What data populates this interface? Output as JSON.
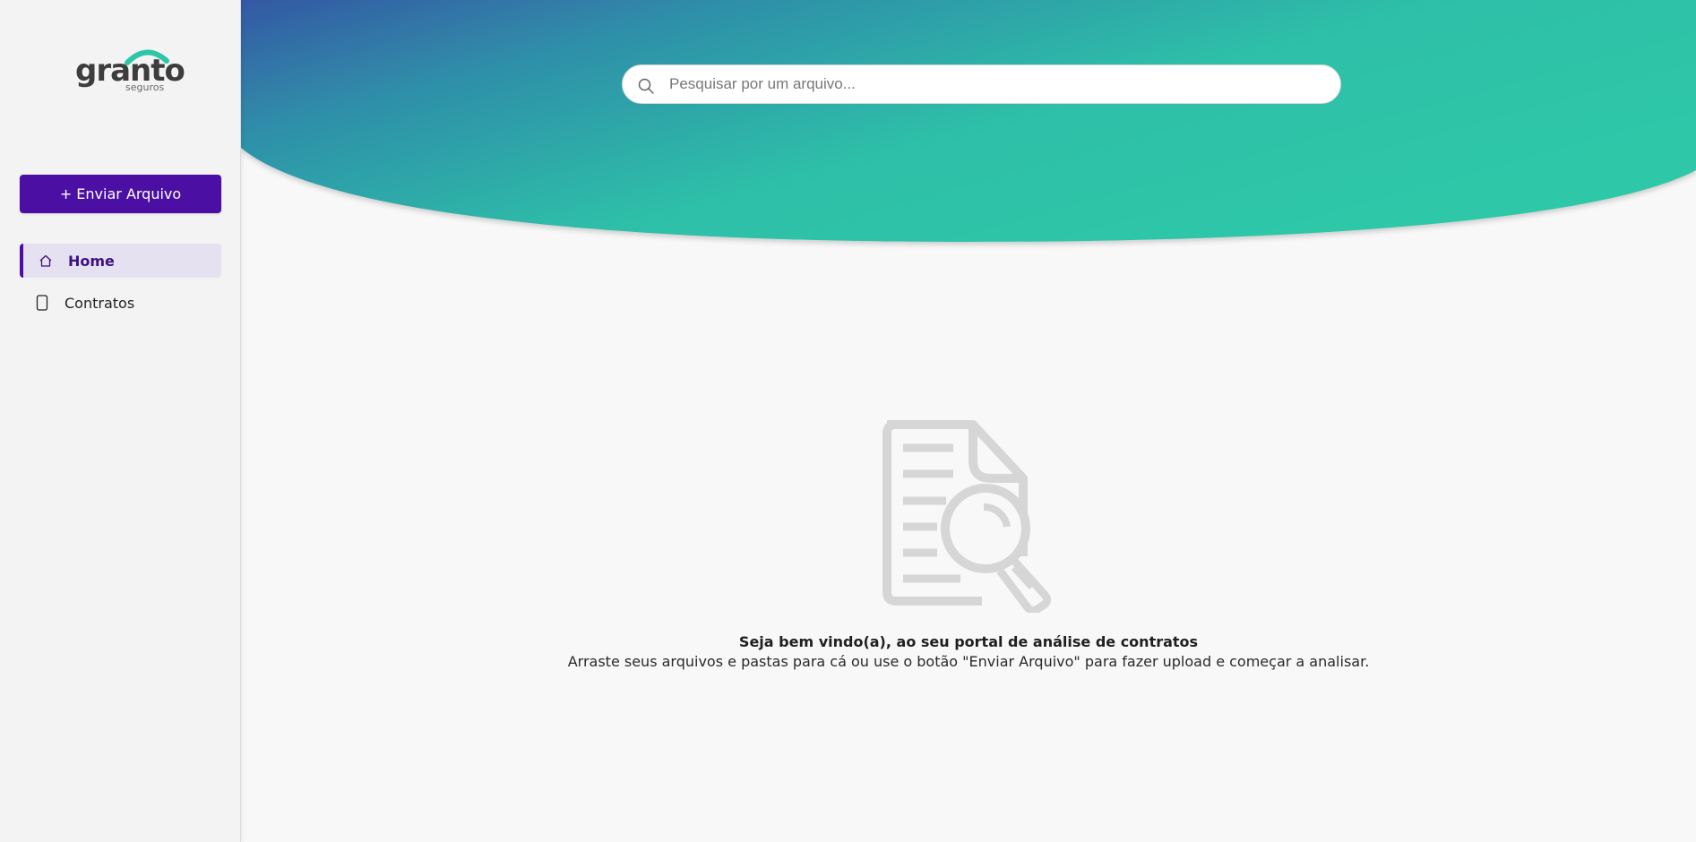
{
  "brand": {
    "logo_word": "granto",
    "logo_sub": "seguros",
    "primary_color": "#4c0fa4",
    "gradient_start": "#3a5aa8",
    "gradient_end": "#2ec6a8"
  },
  "sidebar": {
    "upload_button_label": "+ Enviar Arquivo",
    "items": [
      {
        "label": "Home",
        "icon": "home-icon",
        "active": true
      },
      {
        "label": "Contratos",
        "icon": "phone-icon",
        "active": false
      }
    ]
  },
  "search": {
    "placeholder": "Pesquisar por um arquivo...",
    "value": ""
  },
  "empty_state": {
    "icon": "document-search-icon",
    "title": "Seja bem vindo(a), ao seu portal de análise de contratos",
    "subtitle": "Arraste seus arquivos e pastas para cá ou use o botão \"Enviar Arquivo\" para fazer upload e começar a analisar."
  }
}
